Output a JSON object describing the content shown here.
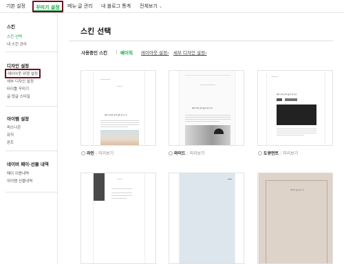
{
  "topnav": {
    "tabs": [
      {
        "label": "기본 설정"
      },
      {
        "label": "꾸미기 설정"
      },
      {
        "label": "메뉴·글 관리"
      },
      {
        "label": "내 블로그 통계"
      },
      {
        "label": "전체보기"
      }
    ]
  },
  "sidebar": {
    "sections": [
      {
        "title": "스킨",
        "items": [
          "스킨 선택",
          "내 스킨 관리"
        ]
      },
      {
        "title": "디자인 설정",
        "items": [
          "레이아웃·위젯 설정",
          "세부 디자인 설정",
          "타이틀 꾸미기",
          "글·댓글 스타일"
        ]
      },
      {
        "title": "아이템 설정",
        "items": [
          "퍼스나콘",
          "뮤직",
          "폰트"
        ]
      },
      {
        "title": "네이버 페이·선물 내역",
        "items": [
          "페이 이용내역",
          "아이템 선물내역"
        ]
      }
    ]
  },
  "main": {
    "title": "스킨 선택",
    "filters": {
      "current": "사용중인 스킨",
      "basic": "베이직",
      "layout_link": "레이아웃 설정",
      "detail_link": "세부 디자인 설정"
    },
    "skins": [
      {
        "name": "라인",
        "preview": "미리보기",
        "post_title": "제목 한국어 글이 들어 갈 자 리"
      },
      {
        "name": "와이드",
        "preview": "미리보기",
        "post_title": "제목 이하 글이 들어 갈 자 리"
      },
      {
        "name": "도큐먼트",
        "preview": "미리보기",
        "post_title": "제목 이하 글이 들어 갈 자리"
      }
    ],
    "row2_caption": "제목이 들어 갑니다"
  },
  "colors": {
    "accent": "#18a548",
    "highlight_border": "#6b1020"
  }
}
